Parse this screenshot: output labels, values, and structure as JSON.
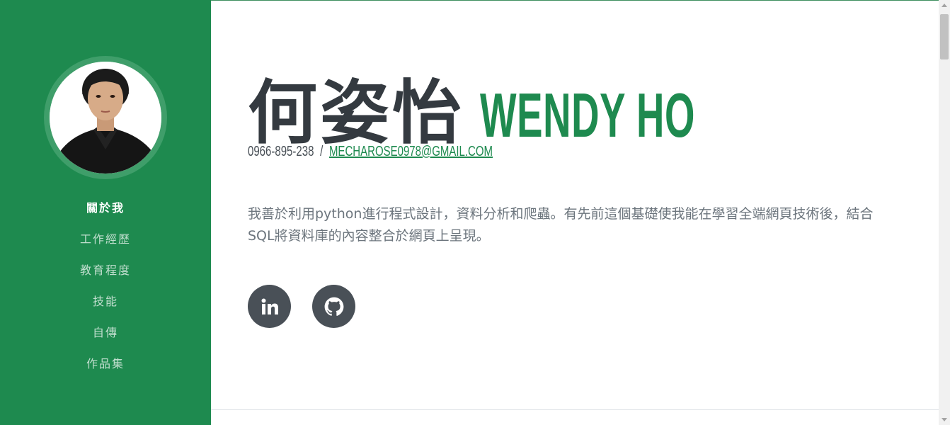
{
  "sidebar": {
    "avatar_alt": "profile photo",
    "nav": [
      {
        "label": "關於我",
        "active": true
      },
      {
        "label": "工作經歷",
        "active": false
      },
      {
        "label": "教育程度",
        "active": false
      },
      {
        "label": "技能",
        "active": false
      },
      {
        "label": "自傳",
        "active": false
      },
      {
        "label": "作品集",
        "active": false
      }
    ]
  },
  "header": {
    "name_zh": "何姿怡",
    "name_en": "WENDY HO",
    "phone": "0966-895-238",
    "separator": "/",
    "email": "MECHAROSE0978@GMAIL.COM"
  },
  "about": {
    "text": "我善於利用python進行程式設計，資料分析和爬蟲。有先前這個基礎使我能在學習全端網頁技術後，結合SQL將資料庫的內容整合於網頁上呈現。"
  },
  "social": [
    {
      "icon": "linkedin-icon"
    },
    {
      "icon": "github-icon"
    }
  ],
  "colors": {
    "primary": "#1e8a4f",
    "dark": "#343a40",
    "icon_bg": "#495057",
    "text_muted": "#6c757d"
  }
}
